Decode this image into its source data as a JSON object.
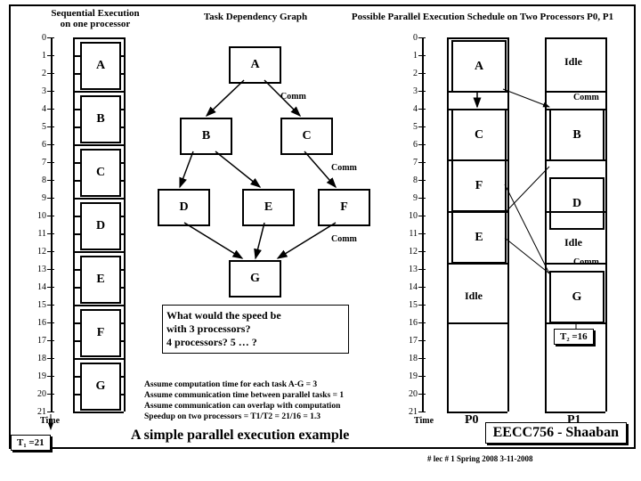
{
  "hdr": {
    "seq": "Sequential Execution\non one processor",
    "dep": "Task Dependency Graph",
    "par": "Possible Parallel Execution Schedule on Two Processors P0, P1"
  },
  "time": "Time",
  "t1": "T₁ =21",
  "t2": "T₂ =16",
  "comm": "Comm",
  "idle": "Idle",
  "tasks": {
    "A": "A",
    "B": "B",
    "C": "C",
    "D": "D",
    "E": "E",
    "F": "F",
    "G": "G"
  },
  "p0": "P0",
  "p1": "P1",
  "question": "What would the speed be\nwith 3 processors?\n4 processors?  5 … ?",
  "assume": "Assume computation time for each task A-G = 3\nAssume communication time between parallel tasks = 1\nAssume communication can overlap with computation\nSpeedup on two processors =  T1/T2  = 21/16 = 1.3",
  "title": "A simple parallel execution example",
  "course": "EECC756 - Shaaban",
  "foot": "#  lec # 1     Spring 2008  3-11-2008",
  "chart_data": {
    "type": "diagram",
    "tasks": [
      "A",
      "B",
      "C",
      "D",
      "E",
      "F",
      "G"
    ],
    "duration": 3,
    "comm": 1,
    "edges": [
      [
        "A",
        "B"
      ],
      [
        "A",
        "C"
      ],
      [
        "B",
        "D"
      ],
      [
        "B",
        "E"
      ],
      [
        "C",
        "F"
      ],
      [
        "D",
        "G"
      ],
      [
        "E",
        "G"
      ],
      [
        "F",
        "G"
      ]
    ],
    "sequential_time": 21,
    "parallel_2p": {
      "P0": [
        [
          "A",
          0,
          3
        ],
        [
          "C",
          4,
          7
        ],
        [
          "F",
          7,
          10
        ],
        [
          "E",
          10,
          13
        ],
        [
          "Idle",
          13,
          16
        ]
      ],
      "P1": [
        [
          "Idle",
          0,
          3
        ],
        [
          "B",
          4,
          7
        ],
        [
          "D",
          8,
          11
        ],
        [
          "Idle",
          11,
          12
        ],
        [
          "G",
          13,
          16
        ]
      ],
      "time": 16
    },
    "speedup": 1.3
  }
}
